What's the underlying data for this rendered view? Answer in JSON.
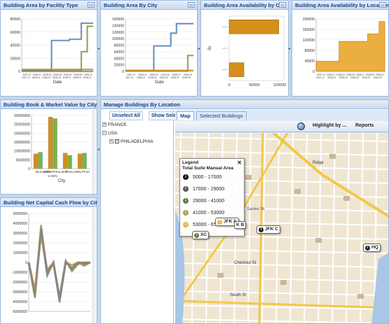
{
  "colors": {
    "blue": "#5b8fd0",
    "olive": "#9aa23a",
    "orange": "#d4901a",
    "green": "#7cb342",
    "gray": "#8a8a8a",
    "panel_border": "#99bbe8"
  },
  "panel1": {
    "title": "Building Area by Facility Type",
    "chart_data": {
      "type": "line",
      "xlabel": "Date",
      "yticks": [
        "80000",
        "60000",
        "40000",
        "20000",
        "0"
      ],
      "x_ticks_top": [
        "2007-11",
        "2008-01",
        "2008-03",
        "2008-05",
        "2008-07",
        "2008-09",
        "2008-11"
      ],
      "x_ticks_bottom": [
        "2007-11",
        "2008-01",
        "2008-03",
        "2008-05",
        "2008-07",
        "2008-09",
        "2008-11"
      ],
      "ylim": [
        0,
        85000
      ],
      "x": [
        0,
        1,
        2,
        3,
        4,
        5,
        6,
        7,
        8,
        9,
        10,
        11,
        12
      ],
      "series": [
        {
          "color": "#5b8fd0",
          "values": [
            2000,
            2000,
            2000,
            2000,
            2000,
            50000,
            50000,
            50000,
            52000,
            52000,
            78000,
            78000,
            78000
          ]
        },
        {
          "color": "#9aa23a",
          "values": [
            1000,
            1000,
            1000,
            1000,
            1000,
            1000,
            1000,
            1000,
            1000,
            1000,
            32000,
            73000,
            73000
          ]
        },
        {
          "color": "#d4901a",
          "values": [
            3000,
            3000,
            3000,
            3000,
            3000,
            3000,
            3000,
            3000,
            3000,
            3000,
            3000,
            3000,
            3000
          ]
        },
        {
          "color": "#8a8a8a",
          "values": [
            0,
            0,
            0,
            0,
            0,
            0,
            0,
            0,
            0,
            0,
            0,
            0,
            0
          ]
        }
      ]
    }
  },
  "panel2": {
    "title": "Building Area By City",
    "chart_data": {
      "type": "line",
      "xlabel": "Date",
      "yticks": [
        "160000",
        "140000",
        "120000",
        "100000",
        "80000",
        "60000",
        "40000",
        "20000",
        "0"
      ],
      "x_ticks_top": [
        "2007-11",
        "2008-01",
        "2008-03",
        "2008-05",
        "2008-07",
        "2008-09"
      ],
      "x_ticks_bottom": [
        "2007-11",
        "2008-01",
        "2008-03",
        "2008-05",
        "2008-07",
        "2008-09"
      ],
      "ylim": [
        0,
        165000
      ],
      "x": [
        0,
        1,
        2,
        3,
        4,
        5,
        6,
        7,
        8,
        9,
        10,
        11,
        12
      ],
      "series": [
        {
          "color": "#5b8fd0",
          "values": [
            2000,
            2000,
            2000,
            2000,
            2000,
            80000,
            80000,
            80000,
            120000,
            150000,
            150000,
            150000,
            150000
          ]
        },
        {
          "color": "#9aa23a",
          "values": [
            1000,
            1000,
            1000,
            1000,
            1000,
            1000,
            1000,
            1000,
            1000,
            1000,
            1000,
            50000,
            50000
          ]
        },
        {
          "color": "#d4901a",
          "values": [
            3000,
            3000,
            3000,
            3000,
            3000,
            3000,
            3000,
            3000,
            3000,
            3000,
            3000,
            3000,
            3000
          ]
        }
      ]
    }
  },
  "panel3": {
    "title": "Building Area Availability by City",
    "chart_data": {
      "type": "bar",
      "orientation": "horizontal",
      "xlabel": "",
      "ylabel": "ity",
      "xticks": [
        "0",
        "60000",
        "120000"
      ],
      "xlim": [
        0,
        130000
      ],
      "categories": [
        "",
        "",
        ""
      ],
      "values": [
        118000,
        0,
        35000
      ],
      "colors": [
        "#d4901a",
        "#d4901a",
        "#d4901a"
      ]
    }
  },
  "panel4": {
    "title": "Building Area Availability by Location and",
    "chart_data": {
      "type": "area",
      "yticks": [
        "200000",
        "160000",
        "120000",
        "80000",
        "40000",
        "0"
      ],
      "x_ticks_top": [
        "2007-11",
        "2008-01",
        "2008-03",
        "2008-05",
        "2008-07",
        "2008-09",
        "2008-11"
      ],
      "x_ticks_bottom": [
        "2007-11",
        "2008-01",
        "2008-03",
        "2008-05",
        "2008-07",
        "2008-09"
      ],
      "ylim": [
        0,
        210000
      ],
      "x": [
        0,
        1,
        2,
        3,
        4,
        5,
        6,
        7,
        8,
        9,
        10,
        11,
        12
      ],
      "series": [
        {
          "color": "#e8a020",
          "values": [
            40000,
            40000,
            40000,
            40000,
            120000,
            120000,
            120000,
            120000,
            120000,
            150000,
            150000,
            200000,
            200000
          ]
        }
      ]
    }
  },
  "panel5": {
    "title": "Building Book & Market Value by City",
    "chart_data": {
      "type": "bar",
      "xlabel": "City",
      "yticks": [
        "30000000",
        "25000000",
        "20000000",
        "15000000",
        "10000000",
        "5000000",
        "0"
      ],
      "ylim": [
        0,
        34000000
      ],
      "categories": [
        "BULLION",
        "CAEN",
        "MONTPELLIER",
        "PHILADELPHIA"
      ],
      "tick_label_rows": [
        [
          "BULLION",
          "MONTPELLIER",
          "PHILADELPHIA"
        ],
        [
          "CAEN"
        ]
      ],
      "series": [
        {
          "color": "#d4901a",
          "values": [
            9500000,
            33000000,
            10000000,
            9500000
          ]
        },
        {
          "color": "#7cb342",
          "values": [
            10500000,
            32000000,
            8500000,
            10000000
          ]
        }
      ]
    }
  },
  "panel6": {
    "title": "Building Net Capital Cash Flow by City",
    "chart_data": {
      "type": "line",
      "yticks": [
        "5000000",
        "4000000",
        "3000000",
        "2000000",
        "1000000",
        "0",
        "-1000000",
        "-2000000",
        "-3000000",
        "-4000000",
        "-5000000"
      ],
      "ylim": [
        -5500000,
        5500000
      ],
      "x": [
        0,
        1,
        2,
        3,
        4,
        5,
        6,
        7,
        8,
        9,
        10
      ],
      "series": [
        {
          "color": "#5b8fd0",
          "values": [
            0,
            -3800000,
            3500000,
            -1500000,
            0,
            -4500000,
            0,
            -600000,
            0,
            -200000,
            0
          ]
        },
        {
          "color": "#9aa23a",
          "values": [
            0,
            -3500000,
            4200000,
            -1200000,
            0,
            -3800000,
            200000,
            -1000000,
            -200000,
            0,
            0
          ]
        },
        {
          "color": "#d4901a",
          "values": [
            0,
            -3000000,
            3000000,
            -800000,
            0,
            -4200000,
            0,
            -300000,
            0,
            -400000,
            0
          ]
        },
        {
          "color": "#8a8a8a",
          "values": [
            0,
            -4000000,
            3800000,
            -1000000,
            -200000,
            -4000000,
            100000,
            -800000,
            0,
            0,
            0
          ]
        }
      ]
    }
  },
  "manage": {
    "title": "Manage Buildings By Location",
    "unselect_all": "Unselect All",
    "show_selected": "Show Sele",
    "tree": {
      "france": "FRANCE",
      "usa": "USA",
      "philadelphia": "PHILADELPHIA"
    },
    "tabs": {
      "map": "Map",
      "selected": "Selected Buildings"
    },
    "toolbar": {
      "highlight": "Highlight by ...",
      "reports": "Reports"
    },
    "legend": {
      "title_line1": "Legend",
      "title_line2": "Total Suite Manual Area",
      "close": "✕",
      "rows": [
        {
          "label": "5000 - 17000",
          "color": "#111111"
        },
        {
          "label": "17000 - 29000",
          "color": "#555555"
        },
        {
          "label": "29000 - 41000",
          "color": "#5a7d3a"
        },
        {
          "label": "41000 - 53000",
          "color": "#a8a050"
        },
        {
          "label": "53000 - 65000",
          "color": "#e0b84a"
        }
      ]
    },
    "pins": {
      "jfka": "JFK A",
      "jfkb": "K B",
      "jfkc": "JFK C",
      "xc": "XC",
      "hq": "HQ"
    },
    "street_labels": {
      "chestnut": "Chestnut St",
      "south": "South St",
      "garden": "Garden St",
      "ridge": "Ridge"
    }
  }
}
